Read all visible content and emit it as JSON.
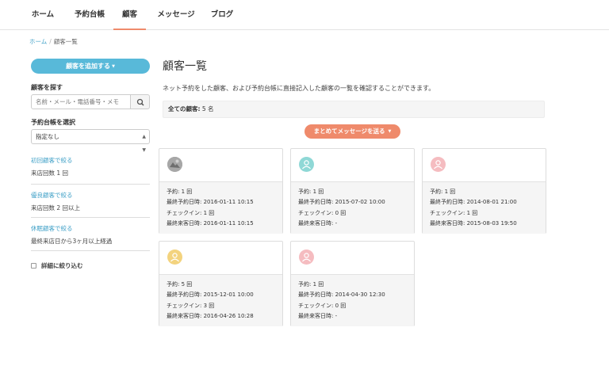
{
  "nav": {
    "tabs": [
      {
        "label": "ホーム"
      },
      {
        "label": "予約台帳"
      },
      {
        "label": "顧客"
      },
      {
        "label": "メッセージ"
      },
      {
        "label": "ブログ"
      }
    ],
    "active_tab": "顧客"
  },
  "breadcrumb": {
    "home": "ホーム",
    "separator": "/",
    "current": "顧客一覧"
  },
  "sidebar": {
    "add_button": "顧客を追加する",
    "search_label": "顧客を探す",
    "search_placeholder": "名前・メール・電話番号・メモ",
    "select_label": "予約台帳を選択",
    "select_value": "指定なし",
    "filters": [
      {
        "link": "初回顧客で絞る",
        "desc": "来店回数 1 回"
      },
      {
        "link": "優良顧客で絞る",
        "desc": "来店回数 2 回以上"
      },
      {
        "link": "休眠顧客で絞る",
        "desc": "最終来店日から3ヶ月以上経過"
      }
    ],
    "detail_filter": "詳細に絞り込む"
  },
  "main": {
    "title": "顧客一覧",
    "description": "ネット予約をした顧客、および予約台帳に直接記入した顧客の一覧を確認することができます。",
    "total_label": "全ての顧客:",
    "total_value": "5 名",
    "message_button": "まとめてメッセージを送る"
  },
  "colors": {
    "accent": "#ef8a6b",
    "primary": "#58b9d9",
    "link": "#3fa0c7"
  },
  "customers": [
    {
      "avatar": "photo",
      "avatar_color": "#9a9a9a",
      "reservations": "予約: 1 回",
      "last_reserved": "最終予約日時: 2016-01-11 10:15",
      "checkins": "チェックイン: 1 回",
      "last_visit": "最終来客日時: 2016-01-11 10:15"
    },
    {
      "avatar": "user-icon",
      "avatar_color": "#8fd8d6",
      "reservations": "予約: 1 回",
      "last_reserved": "最終予約日時: 2015-07-02 10:00",
      "checkins": "チェックイン: 0 回",
      "last_visit": "最終来客日時: -"
    },
    {
      "avatar": "user-icon",
      "avatar_color": "#f5bcc0",
      "reservations": "予約: 1 回",
      "last_reserved": "最終予約日時: 2014-08-01 21:00",
      "checkins": "チェックイン: 1 回",
      "last_visit": "最終来客日時: 2015-08-03 19:50"
    },
    {
      "avatar": "user-icon",
      "avatar_color": "#f3d37e",
      "reservations": "予約: 5 回",
      "last_reserved": "最終予約日時: 2015-12-01 10:00",
      "checkins": "チェックイン: 3 回",
      "last_visit": "最終来客日時: 2016-04-26 10:28"
    },
    {
      "avatar": "user-icon",
      "avatar_color": "#f5bcc0",
      "reservations": "予約: 1 回",
      "last_reserved": "最終予約日時: 2014-04-30 12:30",
      "checkins": "チェックイン: 0 回",
      "last_visit": "最終来客日時: -"
    }
  ]
}
